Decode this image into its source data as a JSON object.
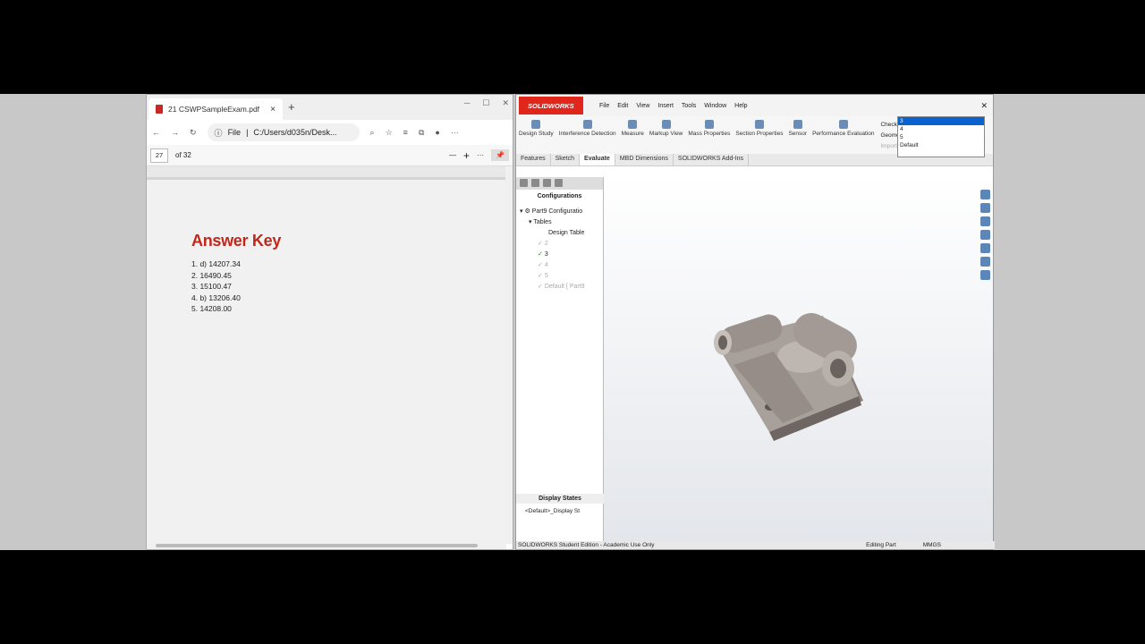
{
  "edge": {
    "tab_title": "21 CSWPSampleExam.pdf",
    "tab_close": "×",
    "new_tab": "+",
    "address_prefix": "File",
    "address": "C:/Users/d035n/Desk...",
    "page_current": "27",
    "page_total": "of 32",
    "zoom_out": "—",
    "zoom_in": "+",
    "more": "···"
  },
  "pdf": {
    "title": "Answer Key",
    "answers": [
      "1. d) 14207.34",
      "2. 16490.45",
      "3. 15100.47",
      "4. b) 13206.40",
      "5. 14208.00"
    ]
  },
  "sw": {
    "logo": "SOLIDWORKS",
    "menu": [
      "File",
      "Edit",
      "View",
      "Insert",
      "Tools",
      "Window",
      "Help"
    ],
    "ribbon": [
      "Design Study",
      "Interference Detection",
      "Measure",
      "Markup View",
      "Mass Properties",
      "Section Properties",
      "Sensor",
      "Performance Evaluation"
    ],
    "ribbon_extra": [
      "Check",
      "Geometry Analysis",
      "Import Diagnostics"
    ],
    "tabs": [
      "Features",
      "Sketch",
      "Evaluate",
      "MBD Dimensions",
      "SOLIDWORKS Add-Ins"
    ],
    "fm_heading": "Configurations",
    "tree": {
      "root": "Part9 Configuratio",
      "tables": "Tables",
      "design_table": "Design Table",
      "configs": [
        "2",
        "3",
        "4",
        "5",
        "Default [ Part9"
      ]
    },
    "display_states_heading": "Display States",
    "display_state": "<Default>_Display St",
    "dropdown": {
      "selected": "3",
      "options": [
        "4",
        "5",
        "Default"
      ]
    },
    "status": {
      "edition": "SOLIDWORKS Student Edition - Academic Use Only",
      "mode": "Editing Part",
      "units": "MMGS"
    }
  }
}
